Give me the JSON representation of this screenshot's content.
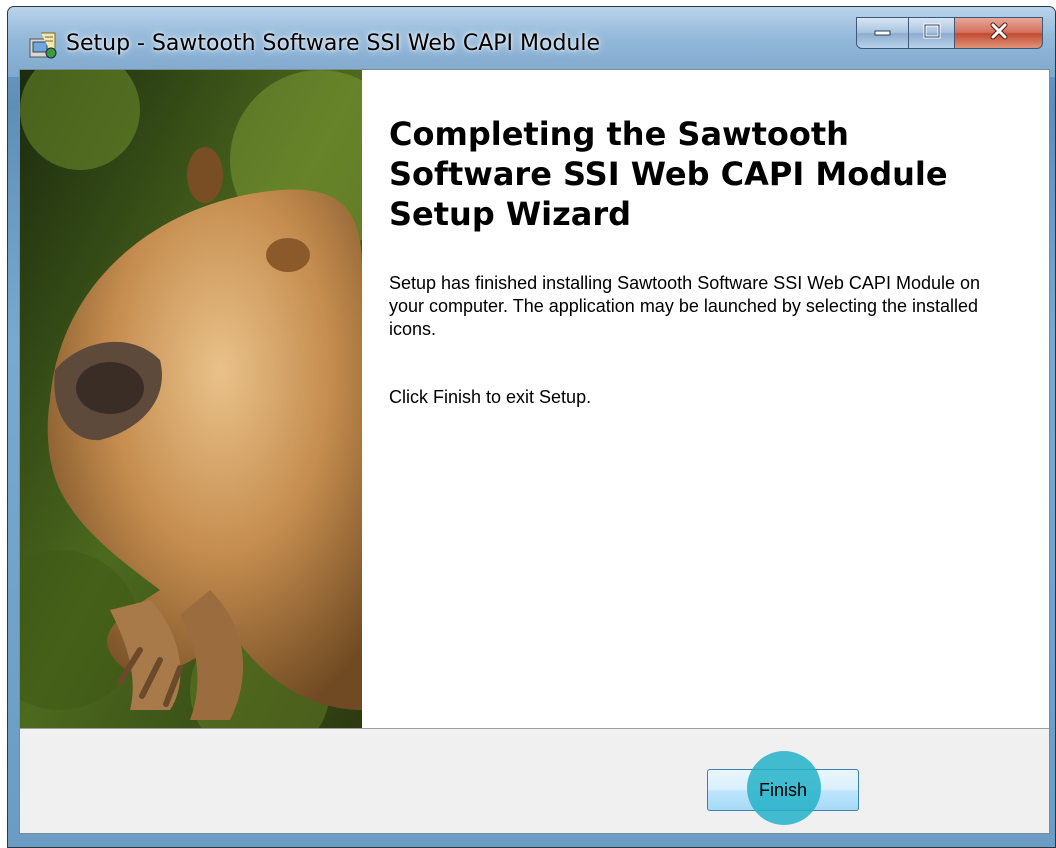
{
  "window": {
    "title": "Setup - Sawtooth Software SSI Web CAPI Module",
    "controls": {
      "minimize_icon": "minimize-icon",
      "maximize_icon": "maximize-icon",
      "close_icon": "close-icon"
    }
  },
  "wizard": {
    "heading": "Completing the Sawtooth Software SSI Web CAPI Module Setup Wizard",
    "message": "Setup has finished installing Sawtooth Software SSI Web CAPI Module on your computer. The application may be launched by selecting the installed icons.",
    "exit_instruction": "Click Finish to exit Setup.",
    "image": "capybara-photo"
  },
  "footer": {
    "finish_label": "Finish"
  },
  "colors": {
    "accent": "#25b2c8",
    "titlebar": "#93b8d9",
    "close": "#c14b31"
  }
}
